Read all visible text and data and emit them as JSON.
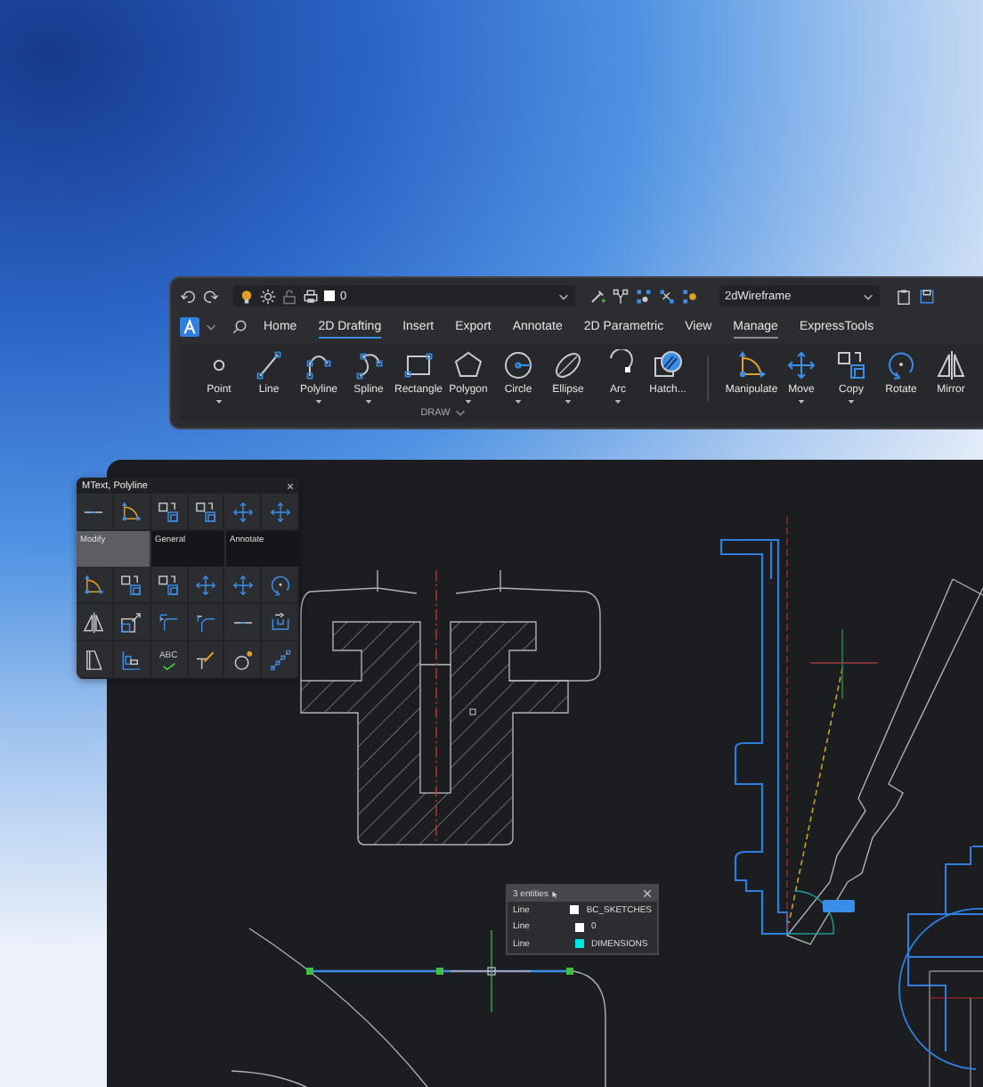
{
  "quick_access": {
    "layer": "0",
    "visual_style": "2dWireframe"
  },
  "tabs": [
    {
      "label": "Home",
      "selected": false,
      "hovered": false
    },
    {
      "label": "2D Drafting",
      "selected": true,
      "hovered": false
    },
    {
      "label": "Insert",
      "selected": false,
      "hovered": false
    },
    {
      "label": "Export",
      "selected": false,
      "hovered": false
    },
    {
      "label": "Annotate",
      "selected": false,
      "hovered": false
    },
    {
      "label": "2D Parametric",
      "selected": false,
      "hovered": false
    },
    {
      "label": "View",
      "selected": false,
      "hovered": false
    },
    {
      "label": "Manage",
      "selected": false,
      "hovered": true
    },
    {
      "label": "ExpressTools",
      "selected": false,
      "hovered": false
    }
  ],
  "draw_panel": {
    "title": "DRAW",
    "tools": [
      {
        "label": "Point",
        "dropdown": true
      },
      {
        "label": "Line",
        "dropdown": false
      },
      {
        "label": "Polyline",
        "dropdown": true
      },
      {
        "label": "Spline",
        "dropdown": true
      },
      {
        "label": "Rectangle",
        "dropdown": false
      },
      {
        "label": "Polygon",
        "dropdown": true
      },
      {
        "label": "Circle",
        "dropdown": true
      },
      {
        "label": "Ellipse",
        "dropdown": true
      },
      {
        "label": "Arc",
        "dropdown": true
      },
      {
        "label": "Hatch...",
        "dropdown": false
      }
    ]
  },
  "modify_tools": [
    {
      "label": "Manipulate",
      "dropdown": false
    },
    {
      "label": "Move",
      "dropdown": true
    },
    {
      "label": "Copy",
      "dropdown": true
    },
    {
      "label": "Rotate",
      "dropdown": false
    },
    {
      "label": "Mirror",
      "dropdown": false
    }
  ],
  "floating_panel": {
    "title": "MText, Polyline",
    "tabs": [
      {
        "label": "Modify",
        "selected": true
      },
      {
        "label": "General",
        "selected": false
      },
      {
        "label": "Annotate",
        "selected": false
      }
    ],
    "spell_check_label": "ABC"
  },
  "selection_popup": {
    "title": "3 entities",
    "rows": [
      {
        "type": "Line",
        "layer": "BC_SKETCHES",
        "color": "#ffffff"
      },
      {
        "type": "Line",
        "layer": "0",
        "color": "#ffffff"
      },
      {
        "type": "Line",
        "layer": "DIMENSIONS",
        "color": "#00e5e5"
      }
    ]
  }
}
